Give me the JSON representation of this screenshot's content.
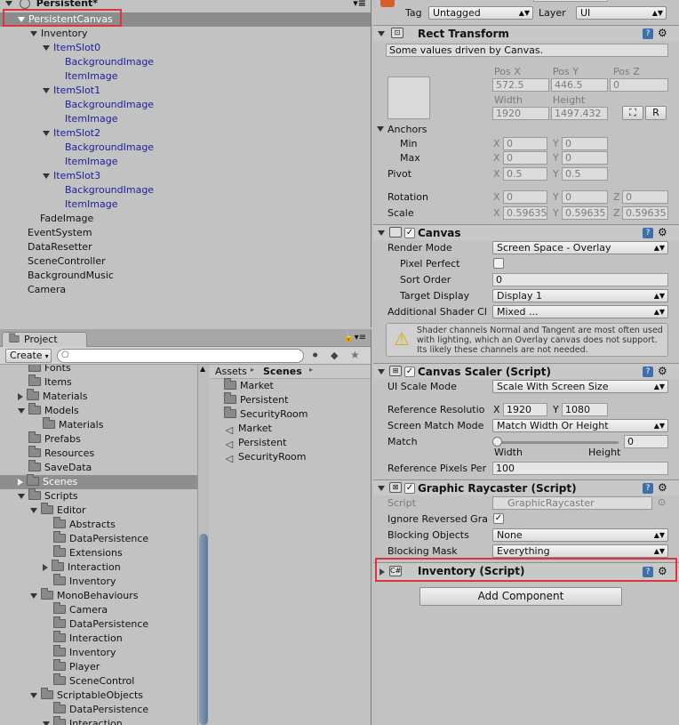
{
  "hierarchy": {
    "scene_title": "Persistent*",
    "items": [
      {
        "label": "PersistentCanvas"
      },
      {
        "label": "Inventory"
      },
      {
        "label": "ItemSlot0"
      },
      {
        "label": "BackgroundImage"
      },
      {
        "label": "ItemImage"
      },
      {
        "label": "ItemSlot1"
      },
      {
        "label": "BackgroundImage"
      },
      {
        "label": "ItemImage"
      },
      {
        "label": "ItemSlot2"
      },
      {
        "label": "BackgroundImage"
      },
      {
        "label": "ItemImage"
      },
      {
        "label": "ItemSlot3"
      },
      {
        "label": "BackgroundImage"
      },
      {
        "label": "ItemImage"
      },
      {
        "label": "FadeImage"
      },
      {
        "label": "EventSystem"
      },
      {
        "label": "DataResetter"
      },
      {
        "label": "SceneController"
      },
      {
        "label": "BackgroundMusic"
      },
      {
        "label": "Camera"
      }
    ]
  },
  "project": {
    "tab_label": "Project",
    "create_label": "Create",
    "tree": [
      {
        "label": "Fonts"
      },
      {
        "label": "Items"
      },
      {
        "label": "Materials"
      },
      {
        "label": "Models"
      },
      {
        "label": "Materials"
      },
      {
        "label": "Prefabs"
      },
      {
        "label": "Resources"
      },
      {
        "label": "SaveData"
      },
      {
        "label": "Scenes"
      },
      {
        "label": "Scripts"
      },
      {
        "label": "Editor"
      },
      {
        "label": "Abstracts"
      },
      {
        "label": "DataPersistence"
      },
      {
        "label": "Extensions"
      },
      {
        "label": "Interaction"
      },
      {
        "label": "Inventory"
      },
      {
        "label": "MonoBehaviours"
      },
      {
        "label": "Camera"
      },
      {
        "label": "DataPersistence"
      },
      {
        "label": "Interaction"
      },
      {
        "label": "Inventory"
      },
      {
        "label": "Player"
      },
      {
        "label": "SceneControl"
      },
      {
        "label": "ScriptableObjects"
      },
      {
        "label": "DataPersistence"
      },
      {
        "label": "Interaction"
      }
    ],
    "breadcrumb_root": "Assets",
    "breadcrumb_current": "Scenes",
    "files": [
      {
        "label": "Market"
      },
      {
        "label": "Persistent"
      },
      {
        "label": "SecurityRoom"
      },
      {
        "label": "Market"
      },
      {
        "label": "Persistent"
      },
      {
        "label": "SecurityRoom"
      }
    ]
  },
  "inspector": {
    "tag_label": "Tag",
    "tag_value": "Untagged",
    "layer_label": "Layer",
    "layer_value": "UI",
    "rect": {
      "title": "Rect Transform",
      "note": "Some values driven by Canvas.",
      "posx_label": "Pos X",
      "posy_label": "Pos Y",
      "posz_label": "Pos Z",
      "posx": "572.5",
      "posy": "446.5",
      "posz": "0",
      "width_label": "Width",
      "height_label": "Height",
      "width": "1920",
      "height": "1497.432",
      "r_label": "R",
      "anchors_label": "Anchors",
      "min_label": "Min",
      "max_label": "Max",
      "x": "X",
      "y": "Y",
      "z": "Z",
      "min_x": "0",
      "min_y": "0",
      "max_x": "0",
      "max_y": "0",
      "pivot_label": "Pivot",
      "pivot_x": "0.5",
      "pivot_y": "0.5",
      "rotation_label": "Rotation",
      "rot_x": "0",
      "rot_y": "0",
      "rot_z": "0",
      "scale_label": "Scale",
      "scale_x": "0.59635",
      "scale_y": "0.59635",
      "scale_z": "0.59635"
    },
    "canvas": {
      "title": "Canvas",
      "render_mode_label": "Render Mode",
      "render_mode": "Screen Space - Overlay",
      "pixel_perfect_label": "Pixel Perfect",
      "sort_order_label": "Sort Order",
      "sort_order": "0",
      "target_display_label": "Target Display",
      "target_display": "Display 1",
      "shader_label": "Additional Shader Cl",
      "shader_value": "Mixed ...",
      "warning": "Shader channels Normal and Tangent are most often used with lighting, which an Overlay canvas does not support. Its likely these channels are not needed."
    },
    "scaler": {
      "title": "Canvas Scaler (Script)",
      "ui_scale_label": "UI Scale Mode",
      "ui_scale": "Scale With Screen Size",
      "ref_res_label": "Reference Resolutio",
      "ref_x": "1920",
      "ref_y": "1080",
      "match_mode_label": "Screen Match Mode",
      "match_mode": "Match Width Or Height",
      "match_label": "Match",
      "match_value": "0",
      "width_label": "Width",
      "height_label": "Height",
      "ref_ppu_label": "Reference Pixels Per",
      "ref_ppu": "100"
    },
    "raycaster": {
      "title": "Graphic Raycaster (Script)",
      "script_label": "Script",
      "script_value": "GraphicRaycaster",
      "ignore_label": "Ignore Reversed Gra",
      "blocking_objects_label": "Blocking Objects",
      "blocking_objects": "None",
      "blocking_mask_label": "Blocking Mask",
      "blocking_mask": "Everything"
    },
    "inventory": {
      "title": "Inventory (Script)"
    },
    "add_component": "Add Component"
  }
}
